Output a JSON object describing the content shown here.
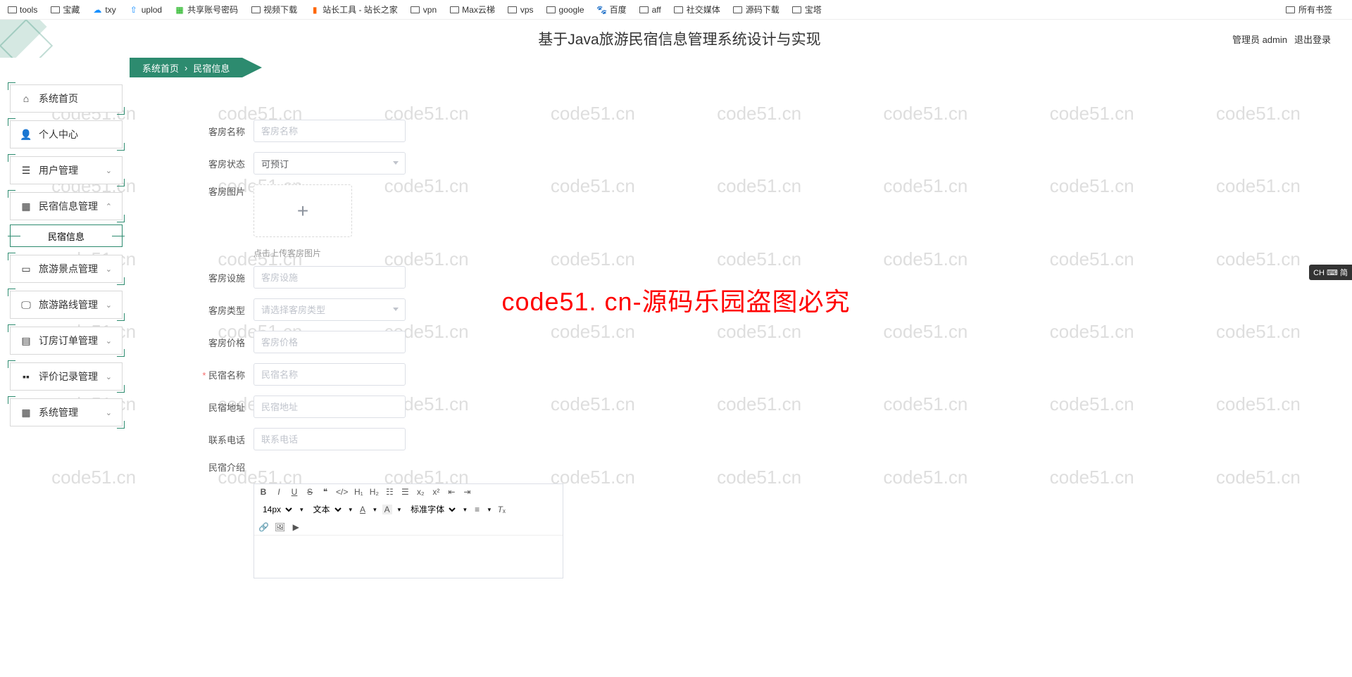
{
  "bookmarks": {
    "left": [
      "tools",
      "宝藏",
      "txy",
      "uplod",
      "共享账号密码",
      "视频下载",
      "站长工具 - 站长之家",
      "vpn",
      "Max云梯",
      "vps",
      "google",
      "百度",
      "aff",
      "社交媒体",
      "源码下载",
      "宝塔"
    ],
    "right": "所有书签"
  },
  "header": {
    "title": "基于Java旅游民宿信息管理系统设计与实现",
    "user_role": "管理员 admin",
    "logout": "退出登录"
  },
  "breadcrumb": {
    "home": "系统首页",
    "current": "民宿信息"
  },
  "sidebar": {
    "items": [
      {
        "label": "系统首页",
        "icon": "home",
        "expandable": false
      },
      {
        "label": "个人中心",
        "icon": "user",
        "expandable": false
      },
      {
        "label": "用户管理",
        "icon": "list",
        "expandable": true
      },
      {
        "label": "民宿信息管理",
        "icon": "grid",
        "expandable": true,
        "expanded": true
      },
      {
        "label": "旅游景点管理",
        "icon": "card",
        "expandable": true
      },
      {
        "label": "旅游路线管理",
        "icon": "screen",
        "expandable": true
      },
      {
        "label": "订房订单管理",
        "icon": "book",
        "expandable": true
      },
      {
        "label": "评价记录管理",
        "icon": "dots",
        "expandable": true
      },
      {
        "label": "系统管理",
        "icon": "apps",
        "expandable": true
      }
    ],
    "submenu": "民宿信息"
  },
  "form": {
    "room_name": {
      "label": "客房名称",
      "placeholder": "客房名称"
    },
    "room_status": {
      "label": "客房状态",
      "value": "可预订"
    },
    "room_image": {
      "label": "客房图片",
      "hint": "点击上传客房图片"
    },
    "room_facility": {
      "label": "客房设施",
      "placeholder": "客房设施"
    },
    "room_type": {
      "label": "客房类型",
      "placeholder": "请选择客房类型"
    },
    "room_price": {
      "label": "客房价格",
      "placeholder": "客房价格"
    },
    "homestay_name": {
      "label": "民宿名称",
      "placeholder": "民宿名称"
    },
    "homestay_addr": {
      "label": "民宿地址",
      "placeholder": "民宿地址"
    },
    "phone": {
      "label": "联系电话",
      "placeholder": "联系电话"
    },
    "intro": {
      "label": "民宿介绍"
    }
  },
  "editor": {
    "font_size": "14px",
    "font_family": "文本",
    "std_font": "标准字体"
  },
  "watermark": "code51.cn",
  "watermark_big": "code51. cn-源码乐园盗图必究",
  "ime": "CH ⌨ 简"
}
